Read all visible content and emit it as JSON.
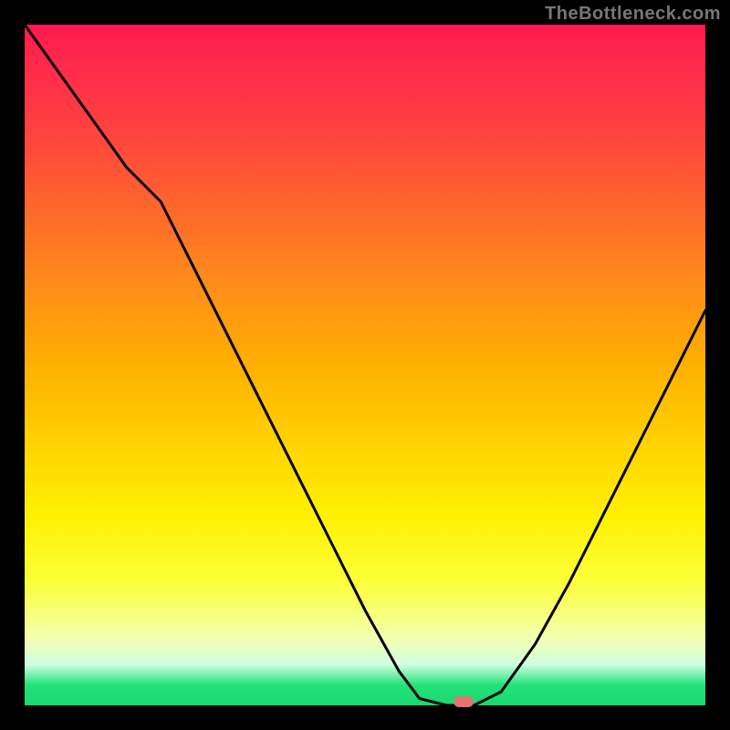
{
  "watermark": "TheBottleneck.com",
  "chart_data": {
    "type": "line",
    "title": "",
    "xlabel": "",
    "ylabel": "",
    "x": [
      0.0,
      0.05,
      0.1,
      0.15,
      0.2,
      0.25,
      0.3,
      0.35,
      0.4,
      0.45,
      0.5,
      0.55,
      0.58,
      0.62,
      0.66,
      0.7,
      0.75,
      0.8,
      0.85,
      0.9,
      0.95,
      1.0
    ],
    "values": [
      1.0,
      0.93,
      0.86,
      0.79,
      0.74,
      0.64,
      0.54,
      0.44,
      0.34,
      0.24,
      0.14,
      0.05,
      0.01,
      0.0,
      0.0,
      0.02,
      0.09,
      0.18,
      0.28,
      0.38,
      0.48,
      0.58
    ],
    "xlim": [
      0,
      1
    ],
    "ylim": [
      0,
      1
    ],
    "marker": {
      "x": 0.645,
      "y": 0.005
    },
    "colors": {
      "curve": "#000000",
      "marker": "#e57373",
      "gradient_top": "#ff1a4d",
      "gradient_mid": "#ffd400",
      "gradient_bottom": "#18d86f"
    }
  }
}
